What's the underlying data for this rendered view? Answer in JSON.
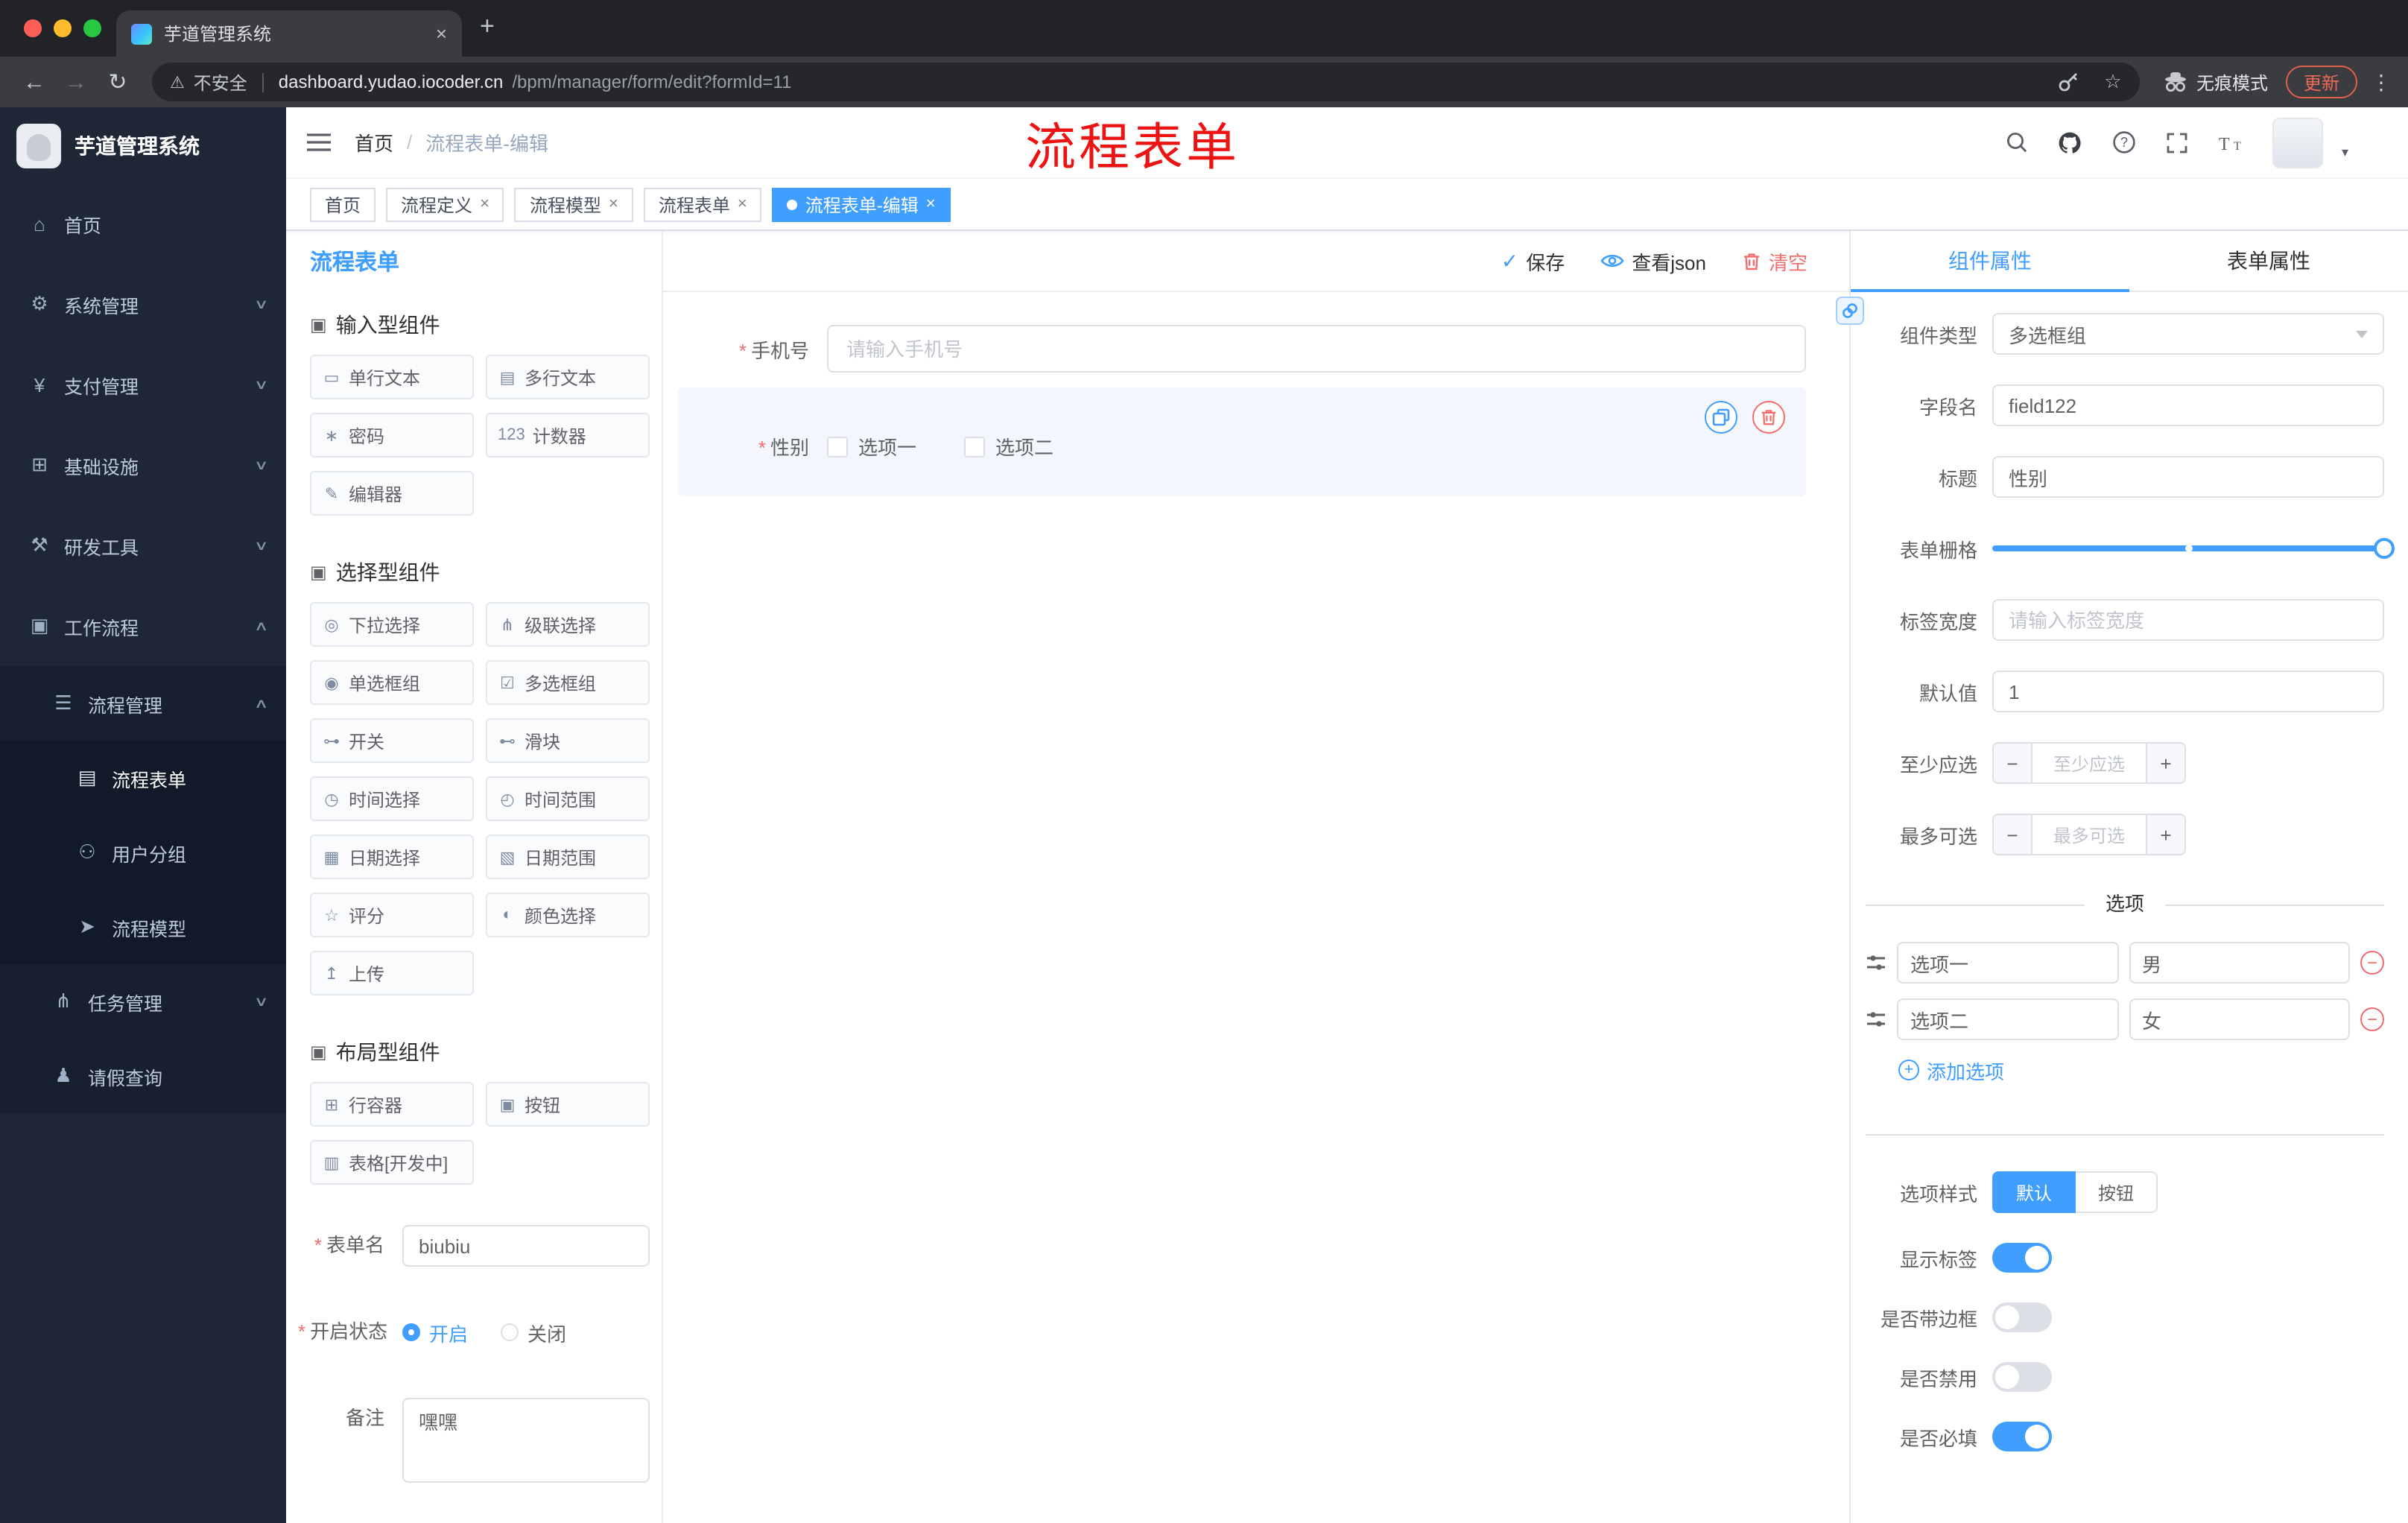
{
  "ui": {
    "required_marker": "*",
    "close_glyph": "×",
    "minus_glyph": "−",
    "plus_glyph": "+",
    "breadcrumb_sep": "/",
    "chevron_down": "∨",
    "chevron_up": "∧",
    "new_tab_glyph": "+",
    "menu_dots": "⋮",
    "back_glyph": "←",
    "forward_glyph": "→",
    "reload_glyph": "↻",
    "star_glyph": "☆",
    "warn_glyph": "⚠",
    "check_glyph": "✓",
    "caret_down": "▾"
  },
  "browser": {
    "tab_title": "芋道管理系统",
    "security_label": "不安全",
    "url_domain": "dashboard.yudao.iocoder.cn",
    "url_path": "/bpm/manager/form/edit?formId=11",
    "incognito_label": "无痕模式",
    "update_label": "更新"
  },
  "sidebar": {
    "logo_title": "芋道管理系统",
    "items": [
      {
        "label": "首页",
        "icon": "⌂"
      },
      {
        "label": "系统管理",
        "icon": "⚙"
      },
      {
        "label": "支付管理",
        "icon": "¥"
      },
      {
        "label": "基础设施",
        "icon": "⊞"
      },
      {
        "label": "研发工具",
        "icon": "⚒"
      },
      {
        "label": "工作流程",
        "icon": "▣"
      },
      {
        "label": "流程管理",
        "icon": "☰"
      },
      {
        "label": "流程表单",
        "icon": "▤"
      },
      {
        "label": "用户分组",
        "icon": "⚇"
      },
      {
        "label": "流程模型",
        "icon": "➤"
      },
      {
        "label": "任务管理",
        "icon": "⋔"
      },
      {
        "label": "请假查询",
        "icon": "♟"
      }
    ]
  },
  "header": {
    "breadcrumb_home": "首页",
    "breadcrumb_current": "流程表单-编辑",
    "annotation": "流程表单"
  },
  "tags": [
    {
      "label": "首页"
    },
    {
      "label": "流程定义"
    },
    {
      "label": "流程模型"
    },
    {
      "label": "流程表单"
    },
    {
      "label": "流程表单-编辑"
    }
  ],
  "designer": {
    "panel_title": "流程表单",
    "toolbar": {
      "save": "保存",
      "view_json": "查看json",
      "clear": "清空"
    },
    "groups": [
      {
        "title": "输入型组件",
        "items": [
          {
            "label": "单行文本",
            "icon": "▭"
          },
          {
            "label": "多行文本",
            "icon": "▤"
          },
          {
            "label": "密码",
            "icon": "∗"
          },
          {
            "label": "计数器",
            "icon": "123"
          },
          {
            "label": "编辑器",
            "icon": "✎"
          }
        ]
      },
      {
        "title": "选择型组件",
        "items": [
          {
            "label": "下拉选择",
            "icon": "◎"
          },
          {
            "label": "级联选择",
            "icon": "⋔"
          },
          {
            "label": "单选框组",
            "icon": "◉"
          },
          {
            "label": "多选框组",
            "icon": "☑"
          },
          {
            "label": "开关",
            "icon": "⊶"
          },
          {
            "label": "滑块",
            "icon": "⊷"
          },
          {
            "label": "时间选择",
            "icon": "◷"
          },
          {
            "label": "时间范围",
            "icon": "◴"
          },
          {
            "label": "日期选择",
            "icon": "▦"
          },
          {
            "label": "日期范围",
            "icon": "▧"
          },
          {
            "label": "评分",
            "icon": "☆"
          },
          {
            "label": "颜色选择",
            "icon": "◐"
          },
          {
            "label": "上传",
            "icon": "↥"
          }
        ]
      },
      {
        "title": "布局型组件",
        "items": [
          {
            "label": "行容器",
            "icon": "⊞"
          },
          {
            "label": "按钮",
            "icon": "▣"
          },
          {
            "label": "表格[开发中]",
            "icon": "▥"
          }
        ]
      }
    ],
    "meta_form": {
      "name_label": "表单名",
      "name_value": "biubiu",
      "status_label": "开启状态",
      "status_on": "开启",
      "status_off": "关闭",
      "remark_label": "备注",
      "remark_value": "嘿嘿"
    },
    "canvas": {
      "phone_label": "手机号",
      "phone_placeholder": "请输入手机号",
      "gender_label": "性别",
      "gender_options": [
        "选项一",
        "选项二"
      ]
    }
  },
  "props": {
    "tab_component": "组件属性",
    "tab_form": "表单属性",
    "type_label": "组件类型",
    "type_value": "多选框组",
    "field_label": "字段名",
    "field_value": "field122",
    "title_label": "标题",
    "title_value": "性别",
    "grid_label": "表单栅格",
    "label_width_label": "标签宽度",
    "label_width_placeholder": "请输入标签宽度",
    "default_label": "默认值",
    "default_value": "1",
    "min_label": "至少应选",
    "min_placeholder": "至少应选",
    "max_label": "最多可选",
    "max_placeholder": "最多可选",
    "options_divider": "选项",
    "options": [
      {
        "label": "选项一",
        "value": "男"
      },
      {
        "label": "选项二",
        "value": "女"
      }
    ],
    "add_option": "添加选项",
    "style_label": "选项样式",
    "style_default": "默认",
    "style_button": "按钮",
    "switch_show_label": "显示标签",
    "switch_border": "是否带边框",
    "switch_disabled": "是否禁用",
    "switch_required": "是否必填"
  },
  "colors": {
    "primary": "#409eff",
    "danger": "#f56c6c",
    "annotation_red": "#ee1313"
  }
}
